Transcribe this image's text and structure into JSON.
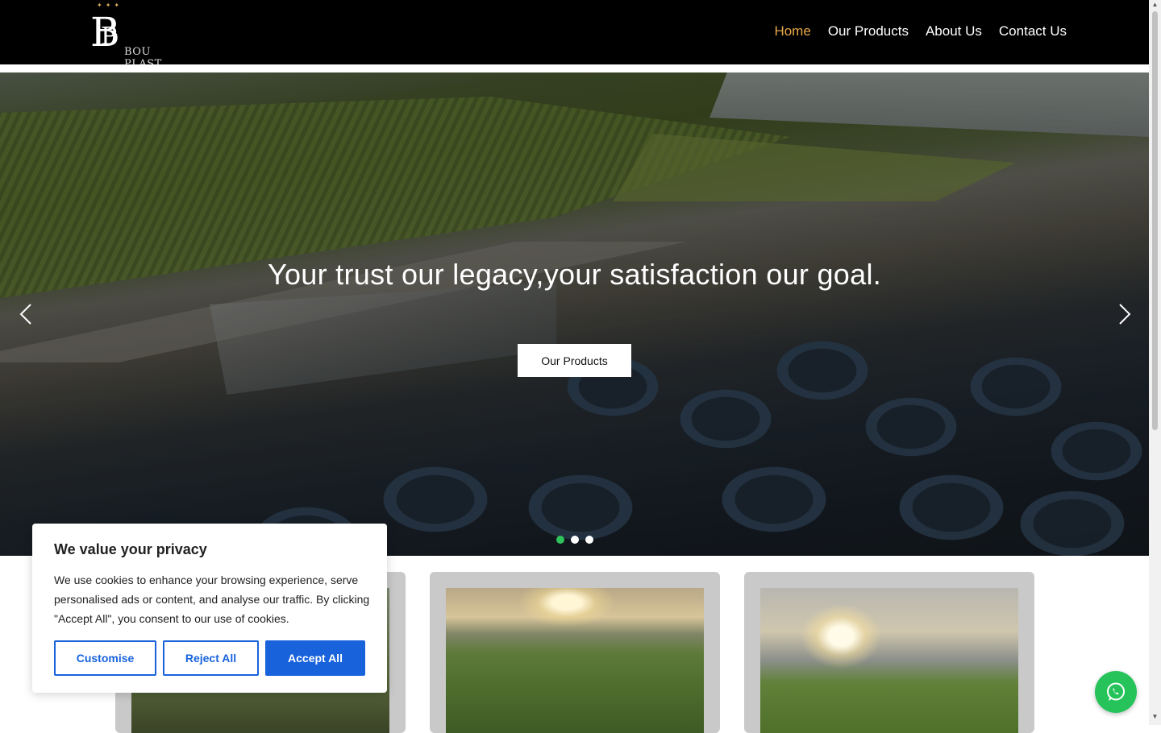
{
  "header": {
    "brand": "BOU PLAST",
    "logo_monogram": "B",
    "nav": [
      {
        "label": "Home",
        "active": true
      },
      {
        "label": "Our Products",
        "active": false
      },
      {
        "label": "About Us",
        "active": false
      },
      {
        "label": "Contact Us",
        "active": false
      }
    ]
  },
  "hero": {
    "title": "Your trust our legacy,your satisfaction our goal.",
    "button_label": "Our Products",
    "slides_count": 3,
    "active_slide": 1
  },
  "cookie_banner": {
    "title": "We value your privacy",
    "body": "We use cookies to enhance your browsing experience, serve personalised ads or content, and analyse our traffic. By clicking \"Accept All\", you consent to our use of cookies.",
    "customise_label": "Customise",
    "reject_label": "Reject All",
    "accept_label": "Accept All"
  },
  "colors": {
    "header_bg": "#000000",
    "nav_active": "#e8a94a",
    "accent_blue": "#1863dc",
    "whatsapp_green": "#25c35a",
    "slider_dot_active": "#2ec25a"
  },
  "icons": {
    "prev": "chevron-left-icon",
    "next": "chevron-right-icon",
    "whatsapp": "whatsapp-icon"
  }
}
